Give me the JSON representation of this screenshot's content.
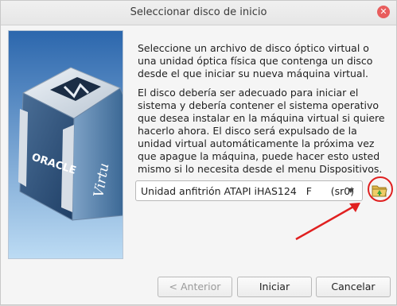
{
  "window": {
    "title": "Seleccionar disco de inicio",
    "close_icon": "close-icon"
  },
  "image_panel": {
    "brand_text": "ORACLE",
    "product_text": "Virtu"
  },
  "description": {
    "paragraph1": "Seleccione un archivo de disco óptico virtual o una unidad óptica física que contenga un disco desde el que iniciar su nueva máquina virtual.",
    "paragraph2": "El disco debería ser adecuado para iniciar el sistema y debería contener el sistema operativo que desea instalar en la máquina virtual si quiere hacerlo ahora. El disco será expulsado de la unidad virtual automáticamente la próxima vez que apague la máquina, puede hacer esto usted mismo si lo necesita desde el menu Dispositivos."
  },
  "drive_select": {
    "selected": "Unidad anfitrión ATAPI iHAS124   F      (sr0)",
    "icon": "chevron-down-icon"
  },
  "open_file_button": {
    "icon": "folder-open-icon"
  },
  "buttons": {
    "back_label": "< Anterior",
    "start_label": "Iniciar",
    "cancel_label": "Cancelar"
  },
  "annotation_color": "#e02020"
}
